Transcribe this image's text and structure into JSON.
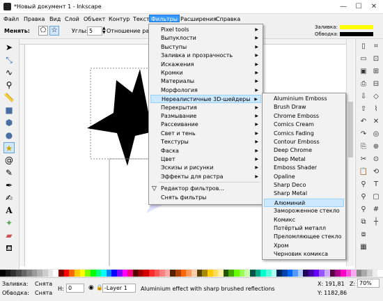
{
  "window": {
    "title": "*Новый документ 1 - Inkscape",
    "minimize": "—",
    "maximize": "☐",
    "close": "✕"
  },
  "menubar": [
    "Файл",
    "Правка",
    "Вид",
    "Слой",
    "Объект",
    "Контур",
    "Текст",
    "Фильтры",
    "Расширения",
    "Справка"
  ],
  "ctrlbar": {
    "change_label": "Менять:",
    "corners_label": "Углы:",
    "corners_value": "5",
    "ratio_label": "Отношение ради",
    "fill_label": "Заливка:",
    "stroke_label": "Обводка:",
    "fill_color": "#ffff00",
    "stroke_color": "#000000"
  },
  "filters_menu": {
    "items": [
      {
        "label": "Pixel tools",
        "sub": true
      },
      {
        "label": "Выпуклости",
        "sub": true
      },
      {
        "label": "Выступы",
        "sub": true
      },
      {
        "label": "Заливка и прозрачность",
        "sub": true
      },
      {
        "label": "Искажения",
        "sub": true
      },
      {
        "label": "Кромки",
        "sub": true
      },
      {
        "label": "Материалы",
        "sub": true
      },
      {
        "label": "Морфология",
        "sub": true
      },
      {
        "label": "Нереалистичные 3D-шейдеры",
        "sub": true
      },
      {
        "label": "Перекрытия",
        "sub": true
      },
      {
        "label": "Размывание",
        "sub": true
      },
      {
        "label": "Рассеивание",
        "sub": true
      },
      {
        "label": "Свет и тень",
        "sub": true
      },
      {
        "label": "Текстуры",
        "sub": true
      },
      {
        "label": "Фаска",
        "sub": true
      },
      {
        "label": "Цвет",
        "sub": true
      },
      {
        "label": "Эскизы и рисунки",
        "sub": true
      },
      {
        "label": "Эффекты для растра",
        "sub": true
      }
    ],
    "editor": "Редактор фильтров...",
    "remove": "Снять фильтры"
  },
  "shaders_submenu": [
    "Aluminium Emboss",
    "Brush Draw",
    "Chrome Emboss",
    "Comics Cream",
    "Comics Fading",
    "Contour Emboss",
    "Deep Chrome",
    "Deep Metal",
    "Emboss Shader",
    "Opaline",
    "Sharp Deco",
    "Sharp Metal",
    "Алюминий",
    "Замороженное стекло",
    "Комикс",
    "Потёртый металл",
    "Преломляющее стекло",
    "Хром",
    "Черновик комикса"
  ],
  "palette_colors": [
    "#000000",
    "#1a1a1a",
    "#333333",
    "#4d4d4d",
    "#666666",
    "#808080",
    "#999999",
    "#b3b3b3",
    "#cccccc",
    "#e6e6e6",
    "#ffffff",
    "#800000",
    "#ff0000",
    "#ff6600",
    "#ffcc00",
    "#ffff00",
    "#80ff00",
    "#00ff00",
    "#00ff80",
    "#00ffff",
    "#0080ff",
    "#0000ff",
    "#8000ff",
    "#ff00ff",
    "#ff0080",
    "#550000",
    "#aa0000",
    "#d40000",
    "#ff2a2a",
    "#ff5555",
    "#ff8080",
    "#ffaaaa",
    "#552200",
    "#aa4400",
    "#ff6600",
    "#ff9955",
    "#ffccaa",
    "#554400",
    "#aa8800",
    "#ffcc00",
    "#ffdd55",
    "#ffeeaa",
    "#225500",
    "#44aa00",
    "#66ff00",
    "#99ff55",
    "#ccffaa",
    "#005544",
    "#00aa88",
    "#00ffcc",
    "#55ffdd",
    "#aaffee",
    "#002255",
    "#0044aa",
    "#0066ff",
    "#5599ff",
    "#aaccff",
    "#220055",
    "#4400aa",
    "#6600ff",
    "#9955ff",
    "#ccaaff",
    "#550044",
    "#aa0088",
    "#ff00cc",
    "#ff55dd",
    "#ffaaee",
    "#888888",
    "#aaaaaa",
    "#cccccc",
    "#eeeeee",
    "#ffffff"
  ],
  "status": {
    "fill_label": "Заливка:",
    "fill_value": "Снята",
    "stroke_label": "Обводка:",
    "stroke_value": "Снята",
    "h_label": "H:",
    "h_value": "0",
    "layer": "-Layer 1",
    "message": "Aluminium effect with sharp brushed reflections",
    "x": "X: 191,81",
    "y": "Y: 1182,86",
    "z": "Z:",
    "zoom": "70%"
  }
}
